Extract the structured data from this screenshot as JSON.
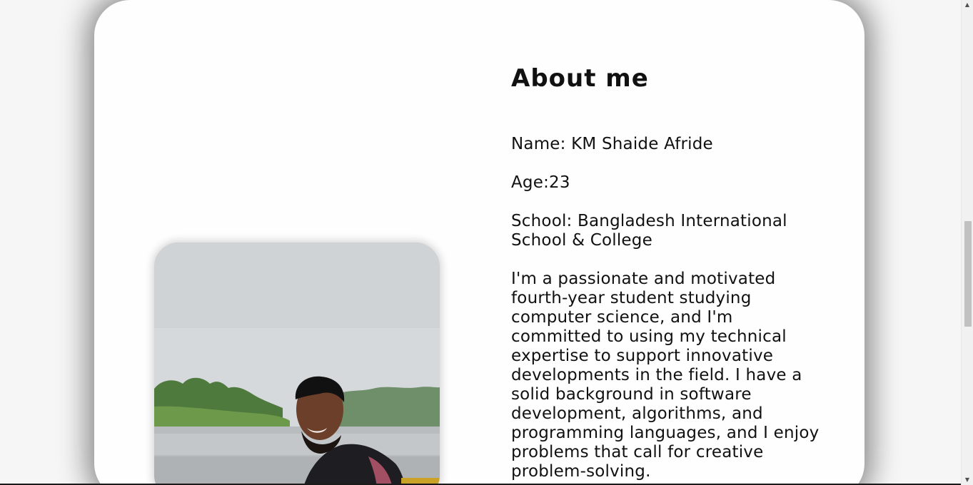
{
  "about": {
    "title": "About me",
    "name": "Name: KM Shaide Afride",
    "age": "Age:23",
    "school": "School: Bangladesh International School & College",
    "bio": "I'm a passionate and motivated fourth-year student studying computer science, and I'm committed to using my technical expertise to support innovative developments in the field. I have a solid background in software development, algorithms, and programming languages, and I enjoy problems that call for creative problem-solving."
  },
  "colors": {
    "page_background": "#f6f6f6",
    "card_background": "#fefefe",
    "text": "#111111"
  },
  "scrollbar": {
    "up_glyph": "▲",
    "down_glyph": "▼",
    "position_fraction": 0.46
  }
}
